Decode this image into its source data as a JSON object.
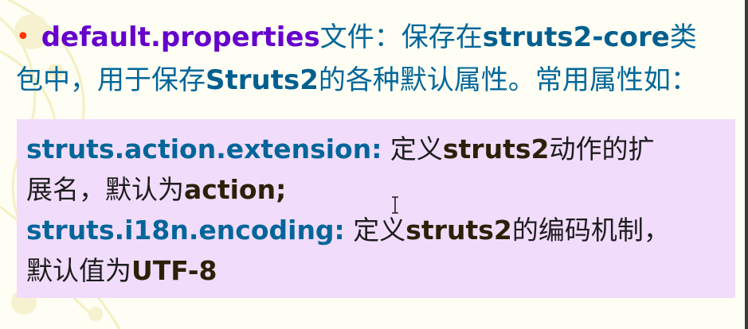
{
  "bullet": {
    "marker": "•",
    "line1": {
      "term": "default.properties",
      "text1": "文件：保存在",
      "core": "struts2-core",
      "text2": "类"
    },
    "line2": {
      "text1": "包中，用于保存",
      "name": "Struts2",
      "text2": "的各种默认属性。常用属性如："
    }
  },
  "panel": {
    "item1": {
      "key": "struts.action.extension:",
      "text1": " 定义",
      "bold1": "struts2",
      "text2": "动作的扩",
      "text3": "展名，默认为",
      "bold2": "action;"
    },
    "item2": {
      "key": "struts.i18n.encoding:",
      "text1": " 定义",
      "bold1": "struts2",
      "text2": "的编码机制，",
      "text3": "默认值为",
      "bold2": "UTF-8"
    }
  },
  "colors": {
    "bullet": "#ff3300",
    "term": "#6600cc",
    "keyword": "#006699",
    "panel_bg": "#f1dcfb"
  },
  "icons": [
    "text-cursor-icon"
  ]
}
